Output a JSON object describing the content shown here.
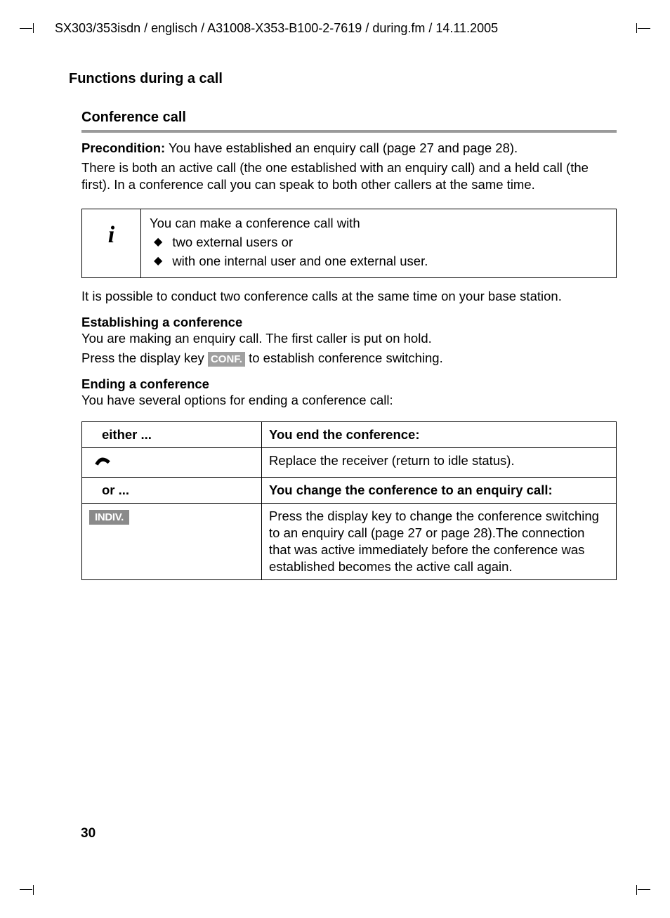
{
  "header_path": "SX303/353isdn / englisch / A31008-X353-B100-2-7619 / during.fm / 14.11.2005",
  "section_title": "Functions during a call",
  "subsection_title": "Conference call",
  "precond_label": "Precondition:",
  "precond_text": " You have established an enquiry call (page 27 and page 28).",
  "intro_para": "There is both an active call (the one established with an enquiry call) and a held call (the first). In a conference call you can speak to both other callers at the same time.",
  "info_icon": "i",
  "info_lead": "You can make a conference call with",
  "info_bullets": [
    "two external users or",
    "with one internal user and one external user."
  ],
  "conduct_para": "It is possible to conduct two conference calls at the same time on your base station.",
  "establishing_heading": "Establishing a conference",
  "establishing_line1": "You are making an enquiry call. The first caller is put on hold.",
  "establishing_line2_pre": "Press the display key ",
  "conf_badge": "CONF.",
  "establishing_line2_post": " to establish conference switching.",
  "ending_heading": "Ending a conference",
  "ending_intro": "You have several options for ending a conference call:",
  "table": {
    "r1c1": "either ...",
    "r1c2": "You end the conference:",
    "r2c1_icon": "hangup",
    "r2c2": "Replace the receiver (return to idle status).",
    "r3c1": "or ...",
    "r3c2": "You change the conference to an enquiry call:",
    "r4c1_badge": "INDIV.",
    "r4c2": "Press the display key to change the conference switching to an enquiry call (page 27 or page 28).The connection that was active immediately before the conference was established becomes the active call again."
  },
  "page_number": "30"
}
